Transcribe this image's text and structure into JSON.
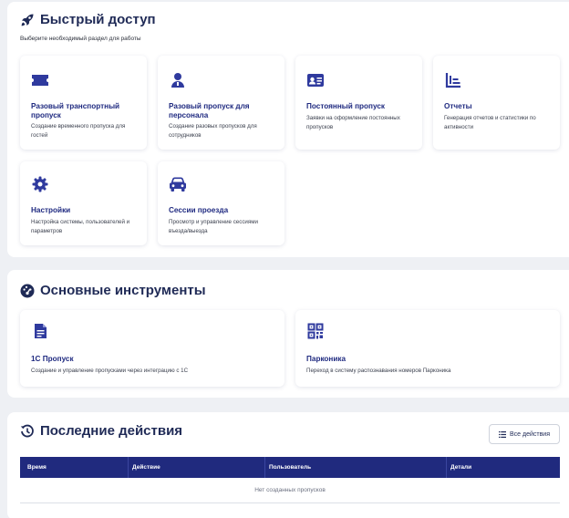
{
  "quick_access": {
    "title": "Быстрый доступ",
    "subtitle": "Выберите необходимый раздел для работы",
    "cards": [
      {
        "title": "Разовый транспортный пропуск",
        "desc": "Создание временного пропуска для гостей",
        "icon": "ticket-icon"
      },
      {
        "title": "Разовый пропуск для персонала",
        "desc": "Создание разовых пропусков для сотрудников",
        "icon": "user-badge-icon"
      },
      {
        "title": "Постоянный пропуск",
        "desc": "Заявки на оформление постоянных пропусков",
        "icon": "id-card-icon"
      },
      {
        "title": "Отчеты",
        "desc": "Генерация отчетов и статистики по активности",
        "icon": "chart-icon"
      },
      {
        "title": "Настройки",
        "desc": "Настройка системы, пользователей и параметров",
        "icon": "gear-icon"
      },
      {
        "title": "Сессии проезда",
        "desc": "Просмотр и управление сессиями въезда/выезда",
        "icon": "car-icon"
      }
    ]
  },
  "tools": {
    "title": "Основные инструменты",
    "cards": [
      {
        "title": "1С Пропуск",
        "desc": "Создание и управление пропусками через интеграцию с 1С",
        "icon": "document-icon"
      },
      {
        "title": "Парконика",
        "desc": "Переход в систему распознавания номеров Парконика",
        "icon": "qr-code-icon"
      }
    ]
  },
  "recent": {
    "title": "Последние действия",
    "all_actions_label": "Все действия",
    "columns": [
      "Время",
      "Действие",
      "Пользователь",
      "Детали"
    ],
    "empty_text": "Нет созданных пропусков"
  },
  "colors": {
    "accent": "#2f3a9e",
    "title": "#1f2a56",
    "card_title": "#1f2a80",
    "table_header": "#202a7e"
  }
}
